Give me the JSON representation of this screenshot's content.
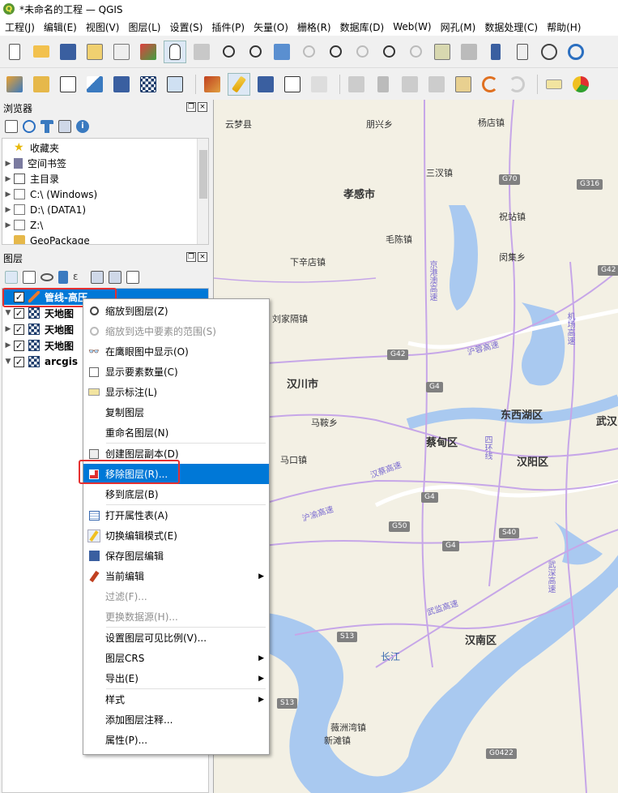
{
  "window": {
    "title": "*未命名的工程 — QGIS"
  },
  "menubar": {
    "items": [
      "工程(J)",
      "编辑(E)",
      "视图(V)",
      "图层(L)",
      "设置(S)",
      "插件(P)",
      "矢量(O)",
      "栅格(R)",
      "数据库(D)",
      "Web(W)",
      "网孔(M)",
      "数据处理(C)",
      "帮助(H)"
    ]
  },
  "browser": {
    "title": "浏览器",
    "items": [
      {
        "label": "收藏夹",
        "icon": "star-icon"
      },
      {
        "label": "空间书签",
        "icon": "bookmark-icon"
      },
      {
        "label": "主目录",
        "icon": "home-icon"
      },
      {
        "label": "C:\\ (Windows)",
        "icon": "folder-icon"
      },
      {
        "label": "D:\\ (DATA1)",
        "icon": "folder-icon"
      },
      {
        "label": "Z:\\",
        "icon": "folder-icon"
      },
      {
        "label": "GeoPackage",
        "icon": "geopackage-icon"
      }
    ]
  },
  "layers": {
    "title": "图层",
    "items": [
      {
        "label": "管线-高压",
        "checked": "✓",
        "selected": true
      },
      {
        "label": "天地图",
        "checked": "✓"
      },
      {
        "label": "天地图",
        "checked": "✓"
      },
      {
        "label": "天地图",
        "checked": "✓"
      },
      {
        "label": "arcgis",
        "checked": "✓"
      }
    ]
  },
  "context_menu": {
    "items": [
      {
        "label": "缩放到图层(Z)",
        "icon": "zoom-layer-icon"
      },
      {
        "label": "缩放到选中要素的范围(S)",
        "icon": "zoom-selection-icon",
        "disabled": true
      },
      {
        "label": "在鹰眼图中显示(O)",
        "icon": "overview-icon"
      },
      {
        "label": "显示要素数量(C)",
        "icon": "checkbox-icon"
      },
      {
        "label": "显示标注(L)",
        "icon": "label-icon"
      },
      {
        "label": "复制图层",
        "icon": ""
      },
      {
        "label": "重命名图层(N)",
        "icon": "",
        "sep_after": true
      },
      {
        "label": "创建图层副本(D)",
        "icon": "duplicate-layer-icon"
      },
      {
        "label": "移除图层(R)...",
        "icon": "remove-layer-icon",
        "highlight": true
      },
      {
        "label": "移到底层(B)",
        "icon": "",
        "sep_after": true
      },
      {
        "label": "打开属性表(A)",
        "icon": "attribute-table-icon"
      },
      {
        "label": "切换编辑模式(E)",
        "icon": "pencil-icon"
      },
      {
        "label": "保存图层编辑",
        "icon": "save-edits-icon"
      },
      {
        "label": "当前编辑",
        "icon": "current-edits-icon",
        "submenu": "▶"
      },
      {
        "label": "过滤(F)...",
        "icon": "",
        "disabled": true
      },
      {
        "label": "更换数据源(H)...",
        "icon": "",
        "disabled": true,
        "sep_after": true
      },
      {
        "label": "设置图层可见比例(V)...",
        "icon": ""
      },
      {
        "label": "图层CRS",
        "icon": "",
        "submenu": "▶"
      },
      {
        "label": "导出(E)",
        "icon": "",
        "submenu": "▶",
        "sep_after": true
      },
      {
        "label": "样式",
        "icon": "",
        "submenu": "▶"
      },
      {
        "label": "添加图层注释...",
        "icon": ""
      },
      {
        "label": "属性(P)...",
        "icon": ""
      }
    ]
  },
  "map": {
    "labels": [
      {
        "text": "云梦县"
      },
      {
        "text": "朋兴乡"
      },
      {
        "text": "杨店镇"
      },
      {
        "text": "三汊镇"
      },
      {
        "text": "孝感市"
      },
      {
        "text": "祝站镇"
      },
      {
        "text": "毛陈镇"
      },
      {
        "text": "闵集乡"
      },
      {
        "text": "下辛店镇"
      },
      {
        "text": "刘家隔镇"
      },
      {
        "text": "汉川市"
      },
      {
        "text": "东西湖区"
      },
      {
        "text": "马鞍乡"
      },
      {
        "text": "蔡甸区"
      },
      {
        "text": "汉阳区"
      },
      {
        "text": "马口镇"
      },
      {
        "text": "汉南区"
      },
      {
        "text": "长江"
      },
      {
        "text": "薇洲湾镇"
      },
      {
        "text": "新滩镇"
      },
      {
        "text": "武汉"
      },
      {
        "text": "京港澳高速"
      },
      {
        "text": "沪渝高速"
      },
      {
        "text": "汉蔡高速"
      },
      {
        "text": "机场高速"
      },
      {
        "text": "武深高速"
      },
      {
        "text": "四环线"
      },
      {
        "text": "武监高速"
      },
      {
        "text": "沪蓉高速"
      }
    ],
    "shields": [
      "G70",
      "G316",
      "G42",
      "G4",
      "G42",
      "G4",
      "G50",
      "G4",
      "S40",
      "S13",
      "S13",
      "G0422"
    ]
  }
}
